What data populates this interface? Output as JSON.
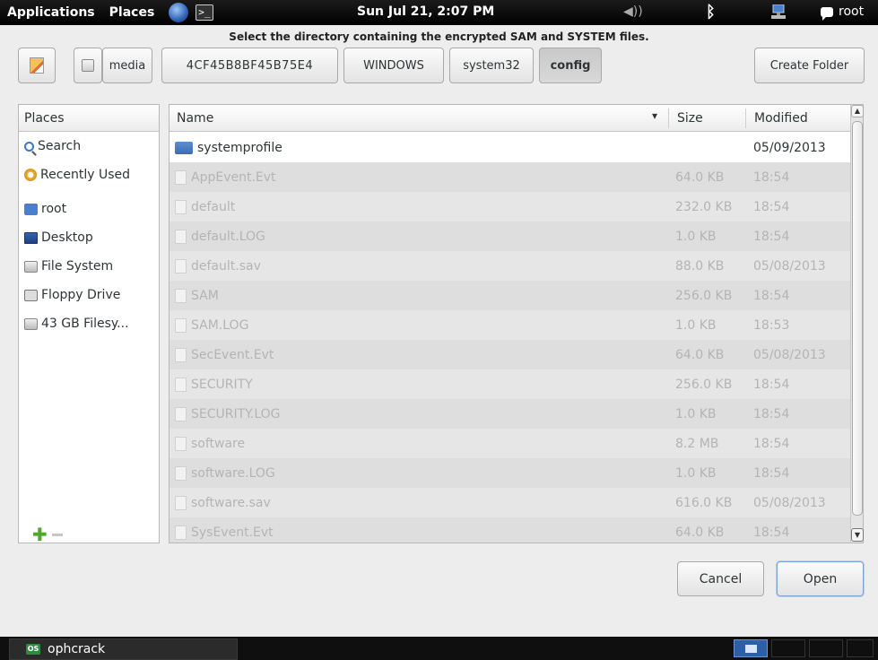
{
  "top_panel": {
    "applications_label": "Applications",
    "places_label": "Places",
    "clock": "Sun Jul 21,  2:07 PM",
    "user": "root"
  },
  "dialog": {
    "title": "Select the directory containing the encrypted SAM and SYSTEM files.",
    "path_segments": [
      "media",
      "4CF45B8BF45B75E4",
      "WINDOWS",
      "system32",
      "config"
    ],
    "create_folder_label": "Create Folder",
    "cancel_label": "Cancel",
    "open_label": "Open"
  },
  "places": {
    "header": "Places",
    "items": [
      {
        "label": "Search",
        "icon": "search-icon"
      },
      {
        "label": "Recently Used",
        "icon": "recently-used-icon"
      },
      {
        "label": "root",
        "icon": "home-folder-icon"
      },
      {
        "label": "Desktop",
        "icon": "desktop-icon"
      },
      {
        "label": "File System",
        "icon": "filesystem-icon"
      },
      {
        "label": "Floppy Drive",
        "icon": "floppy-icon"
      },
      {
        "label": "43 GB Filesy...",
        "icon": "drive-icon"
      }
    ]
  },
  "file_list": {
    "columns": {
      "name": "Name",
      "size": "Size",
      "modified": "Modified"
    },
    "rows": [
      {
        "name": "systemprofile",
        "size": "",
        "modified": "05/09/2013",
        "type": "folder"
      },
      {
        "name": "AppEvent.Evt",
        "size": "64.0 KB",
        "modified": "18:54",
        "type": "file"
      },
      {
        "name": "default",
        "size": "232.0 KB",
        "modified": "18:54",
        "type": "file"
      },
      {
        "name": "default.LOG",
        "size": "1.0 KB",
        "modified": "18:54",
        "type": "file"
      },
      {
        "name": "default.sav",
        "size": "88.0 KB",
        "modified": "05/08/2013",
        "type": "file"
      },
      {
        "name": "SAM",
        "size": "256.0 KB",
        "modified": "18:54",
        "type": "file"
      },
      {
        "name": "SAM.LOG",
        "size": "1.0 KB",
        "modified": "18:53",
        "type": "file"
      },
      {
        "name": "SecEvent.Evt",
        "size": "64.0 KB",
        "modified": "05/08/2013",
        "type": "file"
      },
      {
        "name": "SECURITY",
        "size": "256.0 KB",
        "modified": "18:54",
        "type": "file"
      },
      {
        "name": "SECURITY.LOG",
        "size": "1.0 KB",
        "modified": "18:54",
        "type": "file"
      },
      {
        "name": "software",
        "size": "8.2 MB",
        "modified": "18:54",
        "type": "file"
      },
      {
        "name": "software.LOG",
        "size": "1.0 KB",
        "modified": "18:54",
        "type": "file"
      },
      {
        "name": "software.sav",
        "size": "616.0 KB",
        "modified": "05/08/2013",
        "type": "file"
      },
      {
        "name": "SysEvent.Evt",
        "size": "64.0 KB",
        "modified": "18:54",
        "type": "file"
      }
    ]
  },
  "taskbar": {
    "task_label": "ophcrack",
    "task_icon_text": "OS"
  }
}
